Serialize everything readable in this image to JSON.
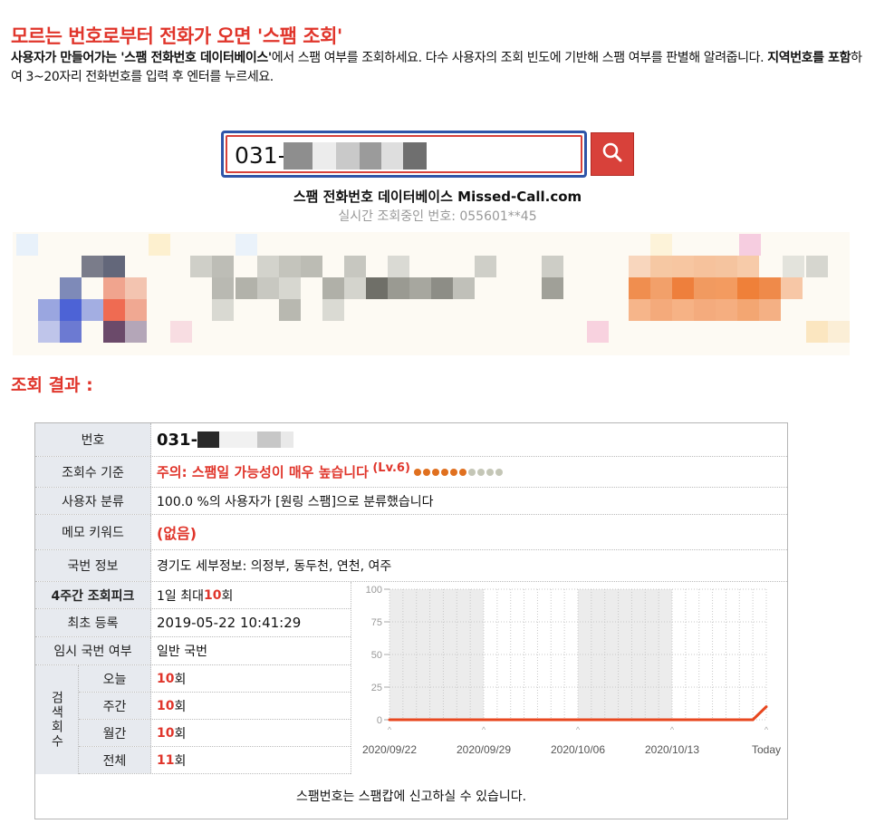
{
  "header": {
    "title": "모르는 번호로부터 전화가 오면 '스팸 조회'",
    "intro_bold1": "사용자가 만들어가는 '스팸 전화번호 데이터베이스'",
    "intro_text1": "에서 스팸 여부를 조회하세요. 다수 사용자의 조회 빈도에 기반해 스팸 여부를 판별해 알려줍니다. ",
    "intro_bold2": "지역번호를 포함",
    "intro_text2": "하여 3~20자리 전화번호를 입력 후 엔터를 누르세요."
  },
  "search": {
    "value": "031-",
    "db_label": "스팸 전화번호 데이터베이스",
    "db_site": "Missed-Call.com",
    "live_lookup": "실시간 조회중인 번호: 055601**45",
    "button_icon": "search-icon"
  },
  "result": {
    "section_title": "조회 결과 :",
    "number_label": "번호",
    "number_value": "031-",
    "basis_label": "조회수 기준",
    "basis_warning": "주의: 스팸일 가능성이 매우 높습니다",
    "basis_level": "(Lv.6)",
    "level_filled": 6,
    "level_total": 10,
    "category_label": "사용자 분류",
    "category_value": "100.0 %의 사용자가 [원링 스팸]으로 분류했습니다",
    "memo_label": "메모 키워드",
    "memo_value": "(없음)",
    "prefix_label": "국번 정보",
    "prefix_value": "경기도 세부정보: 의정부, 동두천, 연천, 여주",
    "peak_label": "4주간 조회피크",
    "peak_prefix": "1일 최대 ",
    "peak_number": "10",
    "peak_suffix": "회",
    "first_label": "최초 등록",
    "first_value": "2019-05-22 10:41:29",
    "temp_label": "임시 국번 여부",
    "temp_value": "일반 국번",
    "count_group_label": "검색회수",
    "counts": [
      {
        "label": "오늘",
        "number": "10",
        "unit": "회"
      },
      {
        "label": "주간",
        "number": "10",
        "unit": "회"
      },
      {
        "label": "월간",
        "number": "10",
        "unit": "회"
      },
      {
        "label": "전체",
        "number": "11",
        "unit": "회"
      }
    ],
    "notice": "스팸번호는 스팸캅에 신고하실 수 있습니다."
  },
  "colors": {
    "accent_red": "#e0352b",
    "search_border": "#2f55a8",
    "label_bg": "#e7eaef",
    "line": "#e8471f",
    "dot_filled": "#e0701f",
    "dot_empty": "#c4c6b6"
  },
  "chart_data": {
    "type": "line",
    "x_labels": [
      "2020/09/22",
      "2020/09/29",
      "2020/10/06",
      "2020/10/13",
      "Today"
    ],
    "y_ticks": [
      0,
      25,
      50,
      75,
      100
    ],
    "ylim": [
      0,
      100
    ],
    "days": 29,
    "values": [
      0,
      0,
      0,
      0,
      0,
      0,
      0,
      0,
      0,
      0,
      0,
      0,
      0,
      0,
      0,
      0,
      0,
      0,
      0,
      0,
      0,
      0,
      0,
      0,
      0,
      0,
      0,
      0,
      10
    ],
    "grid": true
  }
}
